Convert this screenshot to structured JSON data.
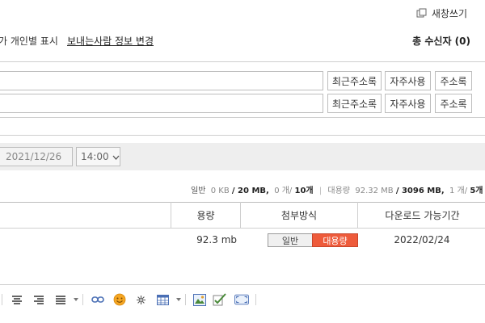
{
  "header": {
    "new_window_label": "새창쓰기",
    "per_person_label": "개인별 표시",
    "per_person_prefix": "가",
    "sender_change_label": "보내는사람 정보 변경",
    "recipient_count": "총 수신자 (0)"
  },
  "address_rows": [
    {
      "recent": "최근주소록",
      "frequent": "자주사용",
      "book": "주소록"
    },
    {
      "recent": "최근주소록",
      "frequent": "자주사용",
      "book": "주소록"
    }
  ],
  "schedule": {
    "date": "2021/12/26",
    "time": "14:00"
  },
  "capacity": {
    "general_label": "일반",
    "general_size": "0 KB",
    "general_limit": "/ 20 MB,",
    "general_count": "0 개/",
    "general_count_limit": "10개",
    "large_label": "대용량",
    "large_size": "92.32 MB",
    "large_limit": "/ 3096 MB,",
    "large_count": "1 개/",
    "large_count_limit": "5개"
  },
  "attachments": {
    "headers": {
      "size": "용량",
      "method": "첨부방식",
      "period": "다운로드 가능기간"
    },
    "rows": [
      {
        "size": "92.3 mb",
        "mode_general": "일반",
        "mode_large": "대용량",
        "period": "2022/02/24"
      }
    ]
  },
  "colors": {
    "accent": "#ee5b3b",
    "border": "#cfcfcf",
    "band": "#eeeeee"
  },
  "toolbar_icons": [
    "align-center-icon",
    "align-right-icon",
    "justify-icon",
    "link-icon",
    "emoticon-icon",
    "special-char-icon",
    "table-icon",
    "image-icon",
    "spellcheck-icon",
    "fullscreen-icon"
  ]
}
